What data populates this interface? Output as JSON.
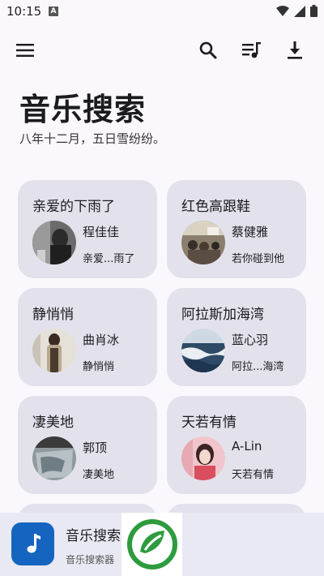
{
  "status_bar": {
    "time": "10:15",
    "notification_letter": "A",
    "icons": [
      "wifi-icon",
      "signal-icon",
      "battery-icon"
    ]
  },
  "toolbar": {
    "icons": [
      "menu-icon",
      "search-icon",
      "playlist-icon",
      "download-icon"
    ]
  },
  "header": {
    "title": "音乐搜索",
    "subtitle": "八年十二月，五日雪纷纷。"
  },
  "songs": [
    {
      "title": "亲爱的下雨了",
      "artist": "程佳佳",
      "album": "亲爱...雨了"
    },
    {
      "title": "红色高跟鞋",
      "artist": "蔡健雅",
      "album": "若你碰到他"
    },
    {
      "title": "静悄悄",
      "artist": "曲肖冰",
      "album": "静悄悄"
    },
    {
      "title": "阿拉斯加海湾",
      "artist": "蓝心羽",
      "album": "阿拉...海湾"
    },
    {
      "title": "凄美地",
      "artist": "郭顶",
      "album": "凄美地"
    },
    {
      "title": "天若有情",
      "artist": "A-Lin",
      "album": "天若有情"
    }
  ],
  "bottom_bar": {
    "app_name": "音乐搜索",
    "app_desc": "音乐搜索器"
  },
  "colors": {
    "background": "#fbf8fd",
    "card": "#e3e2ec",
    "accent": "#1565c0",
    "logo_green": "#2e9b3e"
  }
}
